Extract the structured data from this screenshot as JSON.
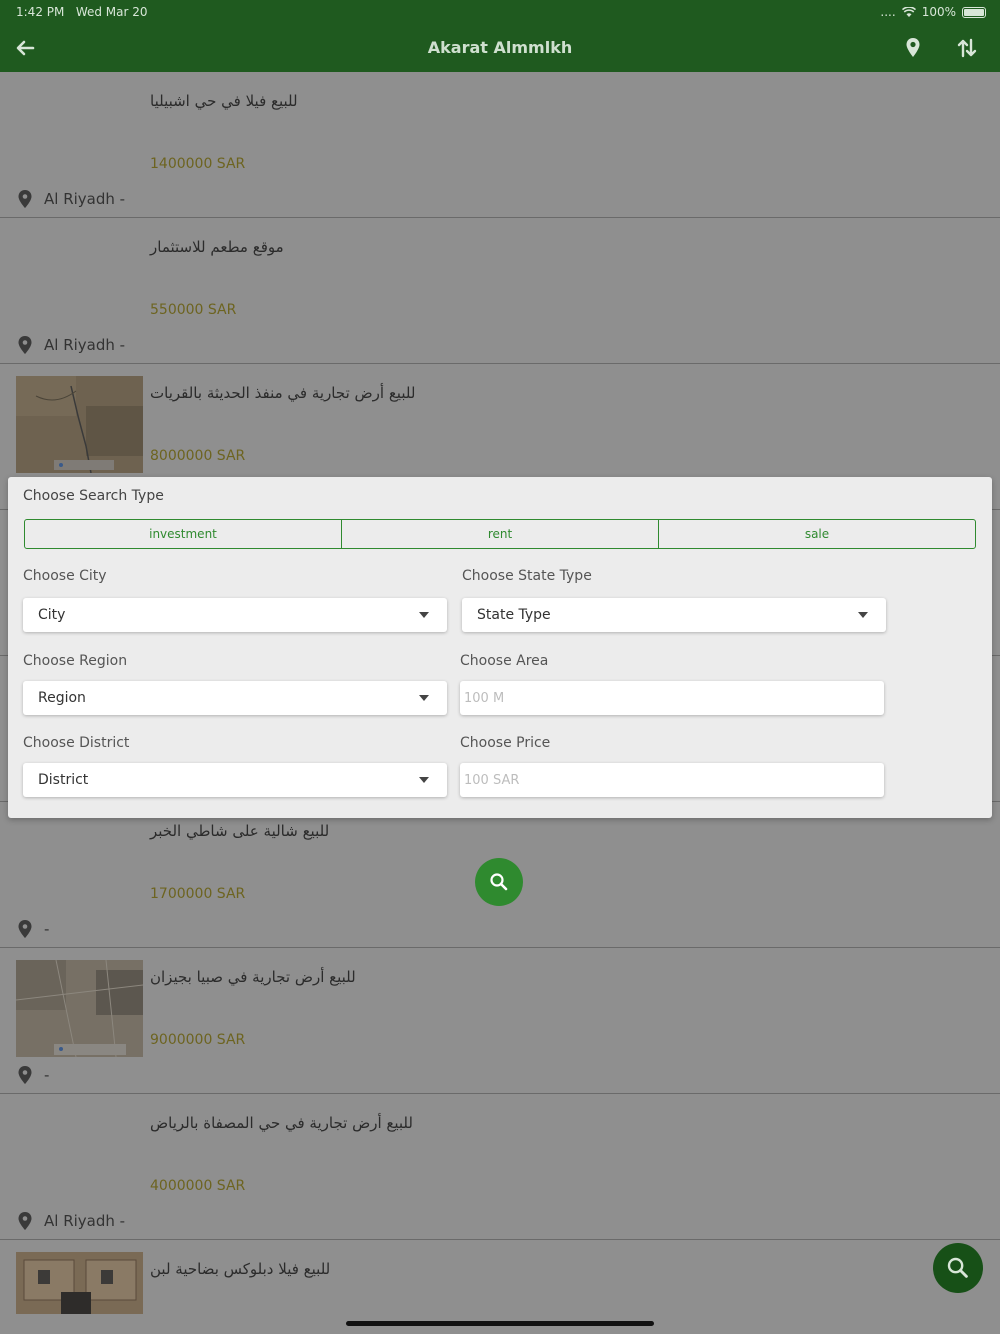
{
  "status_bar": {
    "time": "1:42 PM",
    "date": "Wed Mar 20",
    "battery": "100%",
    "signal": "....",
    "wifi_icon": "wifi-icon"
  },
  "header": {
    "title": "Akarat Almmlkh",
    "back_icon": "back-arrow-icon",
    "map_icon": "location-pin-icon",
    "sort_icon": "sort-arrows-icon"
  },
  "listings": [
    {
      "title": "للبيع فيلا في حي اشبيليا",
      "price": "1400000 SAR",
      "location": "Al Riyadh -",
      "has_image": false
    },
    {
      "title": "موقع مطعم للاستثمار",
      "price": "550000 SAR",
      "location": "Al Riyadh -",
      "has_image": true,
      "image_hidden": true
    },
    {
      "title": "للبيع أرض تجارية في منفذ الحديثة بالقريات",
      "price": "8000000 SAR",
      "location": "",
      "has_image": true
    },
    {
      "title": "",
      "price": "",
      "location": "",
      "has_image": false
    },
    {
      "title": "",
      "price": "",
      "location": "",
      "has_image": false
    },
    {
      "title": "للبيع شالية على شاطي الخبر",
      "price": "1700000 SAR",
      "location": "-",
      "has_image": false
    },
    {
      "title": "للبيع أرض تجارية في صبيا بجيزان",
      "price": "9000000 SAR",
      "location": "-",
      "has_image": true
    },
    {
      "title": "للبيع أرض تجارية في حي المصفاة بالرياض",
      "price": "4000000 SAR",
      "location": "Al Riyadh -",
      "has_image": false
    },
    {
      "title": "للبيع فيلا دبلوكس بضاحية لبن",
      "price": "",
      "location": "",
      "has_image": true
    }
  ],
  "search_modal": {
    "title": "Choose Search Type",
    "types": [
      "investment",
      "rent",
      "sale"
    ],
    "city": {
      "label": "Choose City",
      "value": "City"
    },
    "state_type": {
      "label": "Choose State Type",
      "value": "State Type"
    },
    "region": {
      "label": "Choose Region",
      "value": "Region"
    },
    "area": {
      "label": "Choose Area",
      "placeholder": "100 M"
    },
    "district": {
      "label": "Choose District",
      "value": "District"
    },
    "price": {
      "label": "Choose Price",
      "placeholder": "100 SAR"
    }
  },
  "buttons": {
    "search_icon": "search-icon",
    "fab_icon": "search-icon"
  },
  "colors": {
    "header": "#1f5a1f",
    "accent": "#2f8a2f",
    "price": "#6d6420"
  }
}
